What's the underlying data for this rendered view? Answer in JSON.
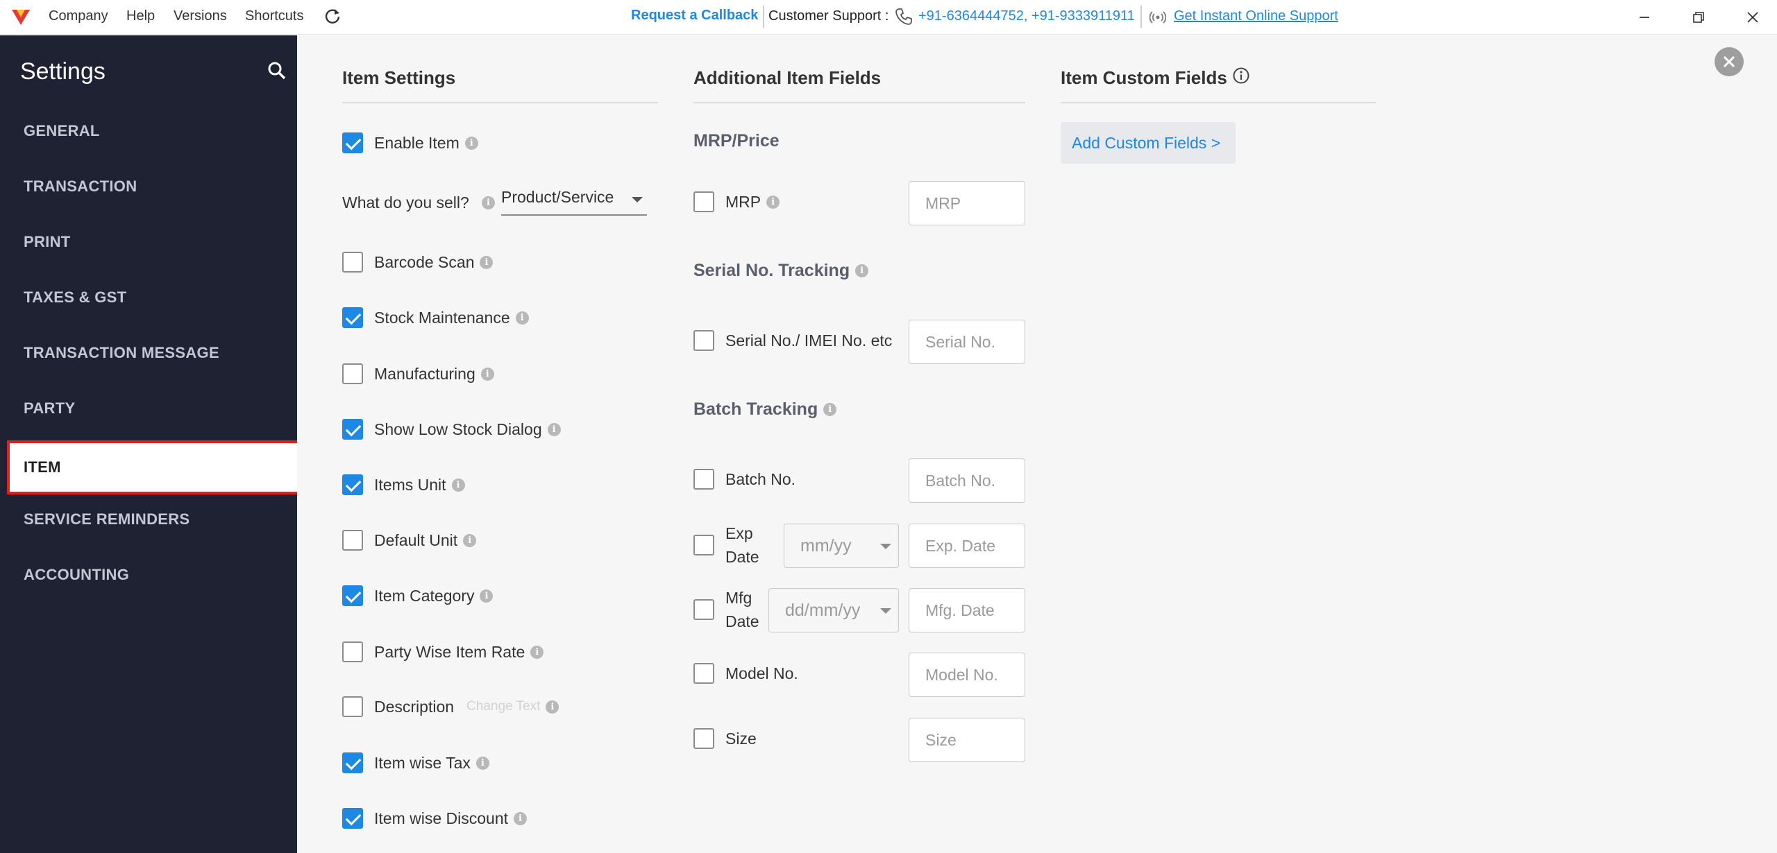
{
  "app": {
    "brand_color": "#e53935",
    "menu": [
      "Company",
      "Help",
      "Versions",
      "Shortcuts"
    ],
    "request_callback": "Request a Callback",
    "support_label": "Customer Support :",
    "support_phones": "+91-6364444752, +91-9333911911",
    "instant_support": "Get Instant Online Support"
  },
  "sidebar": {
    "title": "Settings",
    "items": [
      {
        "label": "GENERAL"
      },
      {
        "label": "TRANSACTION"
      },
      {
        "label": "PRINT"
      },
      {
        "label": "TAXES & GST"
      },
      {
        "label": "TRANSACTION MESSAGE"
      },
      {
        "label": "PARTY"
      },
      {
        "label": "ITEM",
        "active": true
      },
      {
        "label": "SERVICE REMINDERS"
      },
      {
        "label": "ACCOUNTING"
      }
    ]
  },
  "item_settings": {
    "heading": "Item Settings",
    "enable_item": {
      "label": "Enable Item",
      "checked": true
    },
    "what_sell_label": "What do you sell?",
    "what_sell_value": "Product/Service",
    "options": [
      {
        "label": "Barcode Scan",
        "checked": false
      },
      {
        "label": "Stock Maintenance",
        "checked": true
      },
      {
        "label": "Manufacturing",
        "checked": false
      },
      {
        "label": "Show Low Stock Dialog",
        "checked": true
      },
      {
        "label": "Items Unit",
        "checked": true
      },
      {
        "label": "Default Unit",
        "checked": false
      },
      {
        "label": "Item Category",
        "checked": true
      },
      {
        "label": "Party Wise Item Rate",
        "checked": false
      },
      {
        "label": "Description",
        "checked": false
      },
      {
        "label": "Item wise Tax",
        "checked": true
      },
      {
        "label": "Item wise Discount",
        "checked": true
      }
    ],
    "change_text": "Change Text"
  },
  "additional_fields": {
    "heading": "Additional Item Fields",
    "mrp_heading": "MRP/Price",
    "mrp": {
      "label": "MRP",
      "placeholder": "MRP",
      "checked": false
    },
    "serial_heading": "Serial No. Tracking",
    "serial": {
      "label": "Serial No./ IMEI No. etc",
      "placeholder": "Serial No.",
      "checked": false
    },
    "batch_heading": "Batch Tracking",
    "batch_no": {
      "label": "Batch No.",
      "placeholder": "Batch No.",
      "checked": false
    },
    "exp_date": {
      "label_line1": "Exp",
      "label_line2": "Date",
      "format": "mm/yy",
      "placeholder": "Exp. Date",
      "checked": false
    },
    "mfg_date": {
      "label_line1": "Mfg",
      "label_line2": "Date",
      "format": "dd/mm/yy",
      "placeholder": "Mfg. Date",
      "checked": false
    },
    "model_no": {
      "label": "Model No.",
      "placeholder": "Model No.",
      "checked": false
    },
    "size": {
      "label": "Size",
      "placeholder": "Size",
      "checked": false
    }
  },
  "custom_fields": {
    "heading": "Item Custom Fields",
    "add_label": "Add Custom Fields >"
  },
  "colors": {
    "accent": "#1e88e5",
    "sidebar_bg": "#1e2232",
    "highlight": "#e02020"
  }
}
